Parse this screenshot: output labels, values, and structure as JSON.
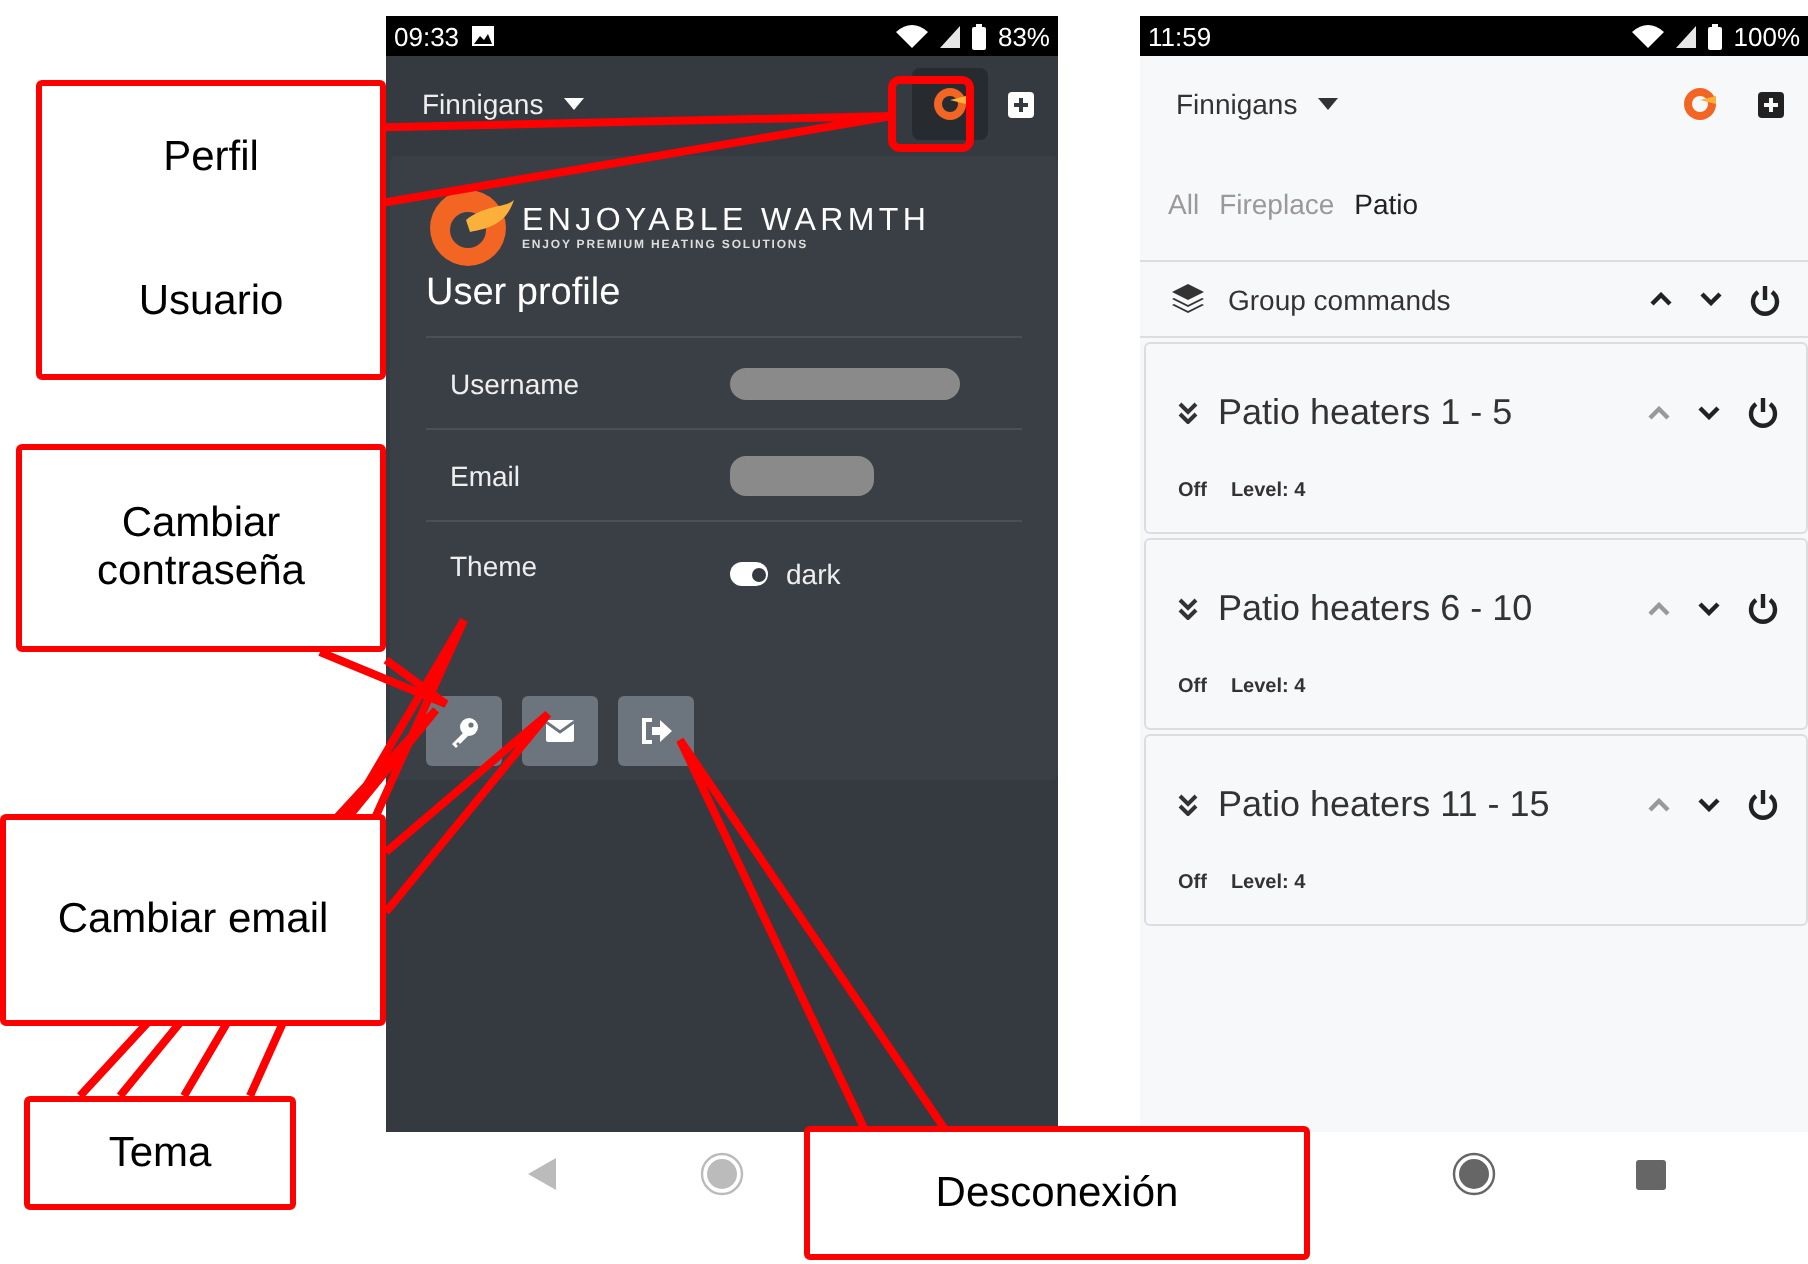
{
  "profile_screen": {
    "status_bar": {
      "time": "09:33",
      "battery": "83%"
    },
    "header": {
      "location": "Finnigans"
    },
    "logo": {
      "name": "ENJOYABLE WARMTH",
      "tagline": "ENJOY PREMIUM HEATING SOLUTIONS"
    },
    "title": "User profile",
    "fields": [
      {
        "label": "Username",
        "kind": "redacted"
      },
      {
        "label": "Email",
        "kind": "redacted"
      },
      {
        "label": "Theme",
        "kind": "toggle",
        "on": true,
        "value": "dark"
      }
    ],
    "actions": [
      {
        "kind": "key"
      },
      {
        "kind": "mail"
      },
      {
        "kind": "logout"
      }
    ]
  },
  "heaters_screen": {
    "status_bar": {
      "time": "11:59",
      "battery": "100%"
    },
    "header": {
      "location": "Finnigans"
    },
    "tabs": [
      {
        "label": "All",
        "selected": false
      },
      {
        "label": "Fireplace",
        "selected": false
      },
      {
        "label": "Patio",
        "selected": true
      }
    ],
    "group_commands": {
      "label": "Group commands"
    },
    "heaters": [
      {
        "name": "Patio heaters 1 - 5",
        "state": "Off",
        "level_text": "Level: 4"
      },
      {
        "name": "Patio heaters 6 - 10",
        "state": "Off",
        "level_text": "Level: 4"
      },
      {
        "name": "Patio heaters 11 - 15",
        "state": "Off",
        "level_text": "Level: 4"
      }
    ]
  },
  "callouts": [
    {
      "texts": [
        "Perfil",
        "Usuario"
      ]
    },
    {
      "texts": [
        "Cambiar contraseña"
      ]
    },
    {
      "texts": [
        "Cambiar email"
      ]
    },
    {
      "texts": [
        "Tema"
      ]
    },
    {
      "texts": [
        "Desconexión"
      ]
    }
  ]
}
